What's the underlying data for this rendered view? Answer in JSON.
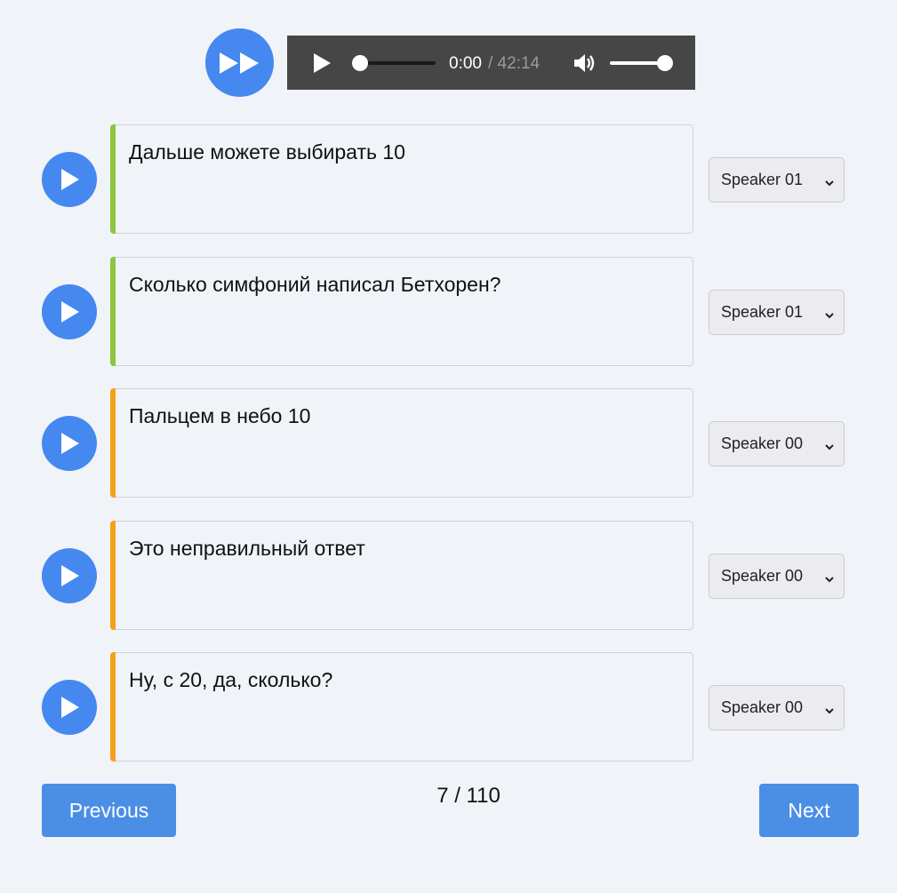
{
  "player": {
    "time_current": "0:00",
    "time_total": " / 42:14",
    "progress": 0,
    "volume": 1.0
  },
  "segments": [
    {
      "text": "Дальше можете выбирать 10",
      "speaker": "Speaker 01",
      "accent_color": "#8cc63f"
    },
    {
      "text": "Сколько симфоний написал Бетхорен?",
      "speaker": "Speaker 01",
      "accent_color": "#8cc63f"
    },
    {
      "text": "Пальцем в небо 10",
      "speaker": "Speaker 00",
      "accent_color": "#f5a01a"
    },
    {
      "text": "Это неправильный ответ",
      "speaker": "Speaker 00",
      "accent_color": "#f5a01a"
    },
    {
      "text": "Ну, с 20, да, сколько?",
      "speaker": "Speaker 00",
      "accent_color": "#f5a01a"
    }
  ],
  "pagination": {
    "previous_label": "Previous",
    "next_label": "Next",
    "page_indicator": "7 / 110"
  },
  "icons": {
    "fast_forward": "fast-forward-icon",
    "play": "play-icon",
    "volume": "volume-icon",
    "chevron": "chevron-down-icon"
  },
  "colors": {
    "accent_blue": "#4588f0",
    "button_blue": "#4a8ee6",
    "background": "#f0f3f8",
    "player_bg": "#464646"
  }
}
